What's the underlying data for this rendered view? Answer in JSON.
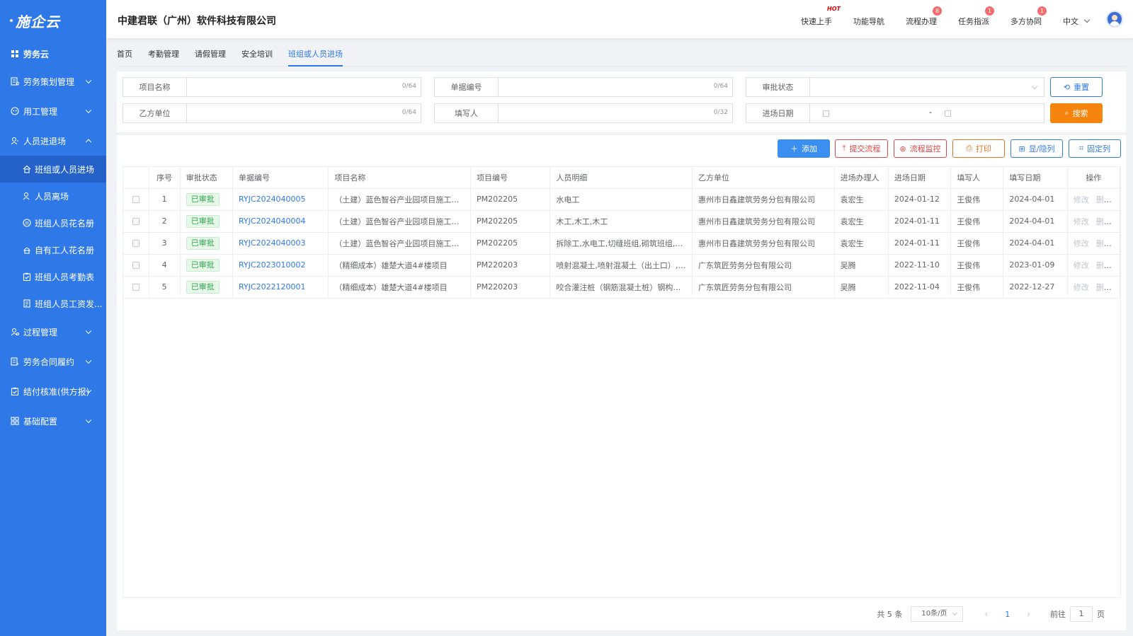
{
  "logo": "施企云",
  "company_name": "中建君联（广州）软件科技有限公司",
  "header_nav": [
    {
      "label": "快速上手",
      "badge": "HOT"
    },
    {
      "label": "功能导航",
      "badge": ""
    },
    {
      "label": "流程办理",
      "badge": "8"
    },
    {
      "label": "任务指派",
      "badge": "1"
    },
    {
      "label": "多方协同",
      "badge": "1"
    }
  ],
  "language": "中文",
  "sidebar": {
    "home": "劳务云",
    "groups": [
      {
        "label": "劳务策划管理",
        "icon": "planning-icon"
      },
      {
        "label": "用工管理",
        "icon": "employment-icon"
      },
      {
        "label": "人员进退场",
        "icon": "personnel-icon",
        "expanded": true
      },
      {
        "label": "过程管理",
        "icon": "process-icon"
      },
      {
        "label": "劳务合同履约",
        "icon": "contract-icon"
      },
      {
        "label": "结付核准(供方报)",
        "icon": "settlement-icon"
      },
      {
        "label": "基础配置",
        "icon": "config-icon"
      }
    ],
    "sub_items": [
      {
        "label": "班组或人员进场",
        "active": true
      },
      {
        "label": "人员离场"
      },
      {
        "label": "班组人员花名册"
      },
      {
        "label": "自有工人花名册"
      },
      {
        "label": "班组人员考勤表"
      },
      {
        "label": "班组人员工资发..."
      }
    ]
  },
  "tabs": [
    "首页",
    "考勤管理",
    "请假管理",
    "安全培训",
    "班组或人员进场"
  ],
  "search": {
    "project_name": {
      "label": "项目名称",
      "counter": "0/64"
    },
    "doc_no": {
      "label": "单据编号",
      "counter": "0/64"
    },
    "approval_status": {
      "label": "审批状态"
    },
    "party_b": {
      "label": "乙方单位",
      "counter": "0/64"
    },
    "filler": {
      "label": "填写人",
      "counter": "0/32"
    },
    "entry_date": {
      "label": "进场日期",
      "separator": "-"
    },
    "reset_label": "重置",
    "search_label": "搜索"
  },
  "toolbar": {
    "add": "添加",
    "submit_flow": "提交流程",
    "flow_monitor": "流程监控",
    "print": "打印",
    "show_hide": "显/隐列",
    "fix_col": "固定列"
  },
  "table": {
    "headers": [
      "序号",
      "审批状态",
      "单据编号",
      "项目名称",
      "项目编号",
      "人员明细",
      "乙方单位",
      "进场办理人",
      "进场日期",
      "填写人",
      "填写日期",
      "操作"
    ],
    "rows": [
      {
        "no": "1",
        "status": "已审批",
        "doc": "RYJC2024040005",
        "project": "（土建）蓝色智谷产业园项目施工总...",
        "pcode": "PM202205",
        "staff": "水电工",
        "party": "惠州市日鑫建筑劳务分包有限公司",
        "handler": "袁宏生",
        "date": "2024-01-12",
        "filler": "王俊伟",
        "fdate": "2024-04-01"
      },
      {
        "no": "2",
        "status": "已审批",
        "doc": "RYJC2024040004",
        "project": "（土建）蓝色智谷产业园项目施工总...",
        "pcode": "PM202205",
        "staff": "木工,木工,木工",
        "party": "惠州市日鑫建筑劳务分包有限公司",
        "handler": "袁宏生",
        "date": "2024-01-11",
        "filler": "王俊伟",
        "fdate": "2024-04-01"
      },
      {
        "no": "3",
        "status": "已审批",
        "doc": "RYJC2024040003",
        "project": "（土建）蓝色智谷产业园项目施工总...",
        "pcode": "PM202205",
        "staff": "拆除工,水电工,切缝班组,砌筑班组,铺...",
        "party": "惠州市日鑫建筑劳务分包有限公司",
        "handler": "袁宏生",
        "date": "2024-01-11",
        "filler": "王俊伟",
        "fdate": "2024-04-01"
      },
      {
        "no": "4",
        "status": "已审批",
        "doc": "RYJC2023010002",
        "project": "（精细成本）雄楚大道4#楼项目",
        "pcode": "PM220203",
        "staff": "喷射混凝土,喷射混凝土（出土口）,咬...",
        "party": "广东筑匠劳务分包有限公司",
        "handler": "吴腾",
        "date": "2022-11-10",
        "filler": "王俊伟",
        "fdate": "2023-01-09"
      },
      {
        "no": "5",
        "status": "已审批",
        "doc": "RYJC2022120001",
        "project": "（精细成本）雄楚大道4#楼项目",
        "pcode": "PM220203",
        "staff": "咬合灌注桩（钢筋混凝土桩）钢构柱...",
        "party": "广东筑匠劳务分包有限公司",
        "handler": "吴腾",
        "date": "2022-11-04",
        "filler": "王俊伟",
        "fdate": "2022-12-27"
      }
    ],
    "ops": [
      "修改",
      "删除"
    ]
  },
  "pagination": {
    "total": "共 5 条",
    "page_size": "10条/页",
    "current_page": "1",
    "goto_label": "前往",
    "goto_value": "1",
    "page_unit": "页"
  },
  "colors": {
    "sidebar": "#2f78e8",
    "primary": "#2f78e8",
    "search_btn": "#f5840c",
    "approved_tag": "#2fa84f"
  }
}
